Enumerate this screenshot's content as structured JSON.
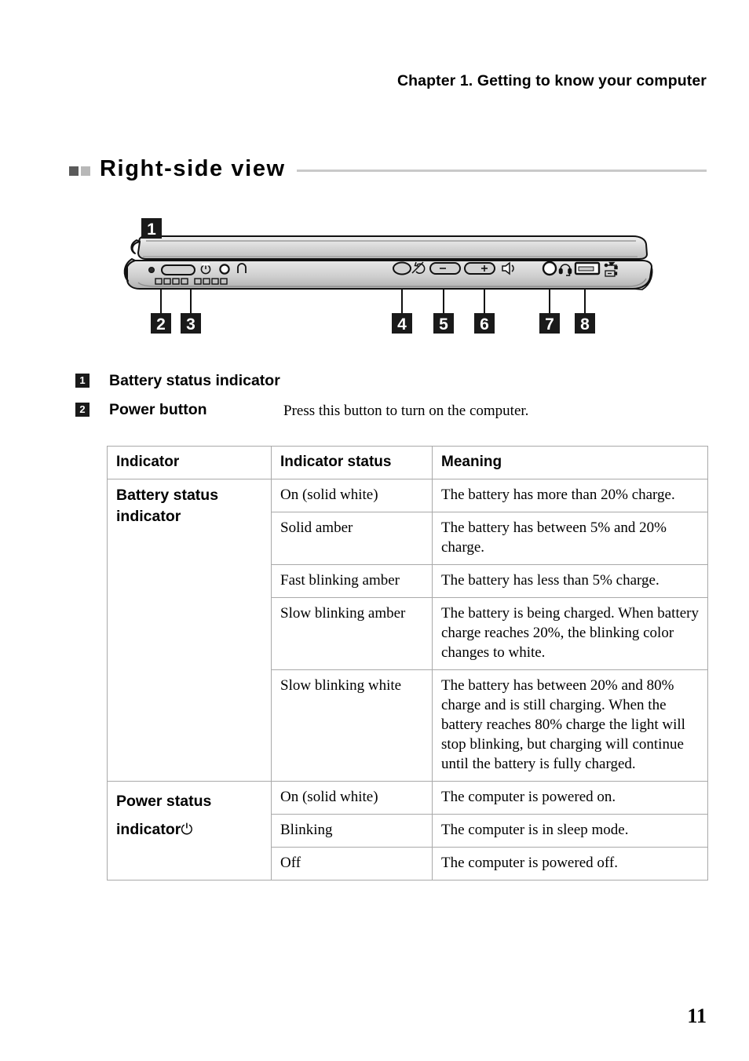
{
  "header": {
    "chapter": "Chapter 1. Getting to know your computer"
  },
  "section": {
    "title": "Right-side view",
    "bullet_dark_color": "#5a5a5a",
    "bullet_light_color": "#b8b8b8",
    "rule_color": "#c9c9c9"
  },
  "figure": {
    "alt": "right-side profile view of the computer",
    "callouts": [
      {
        "number": "1",
        "target": "battery-status-indicator"
      },
      {
        "number": "2",
        "target": "power-button"
      },
      {
        "number": "3",
        "target": "power-status-indicator"
      },
      {
        "number": "4",
        "target": "rotation-lock-button"
      },
      {
        "number": "5",
        "target": "volume-down-button"
      },
      {
        "number": "6",
        "target": "volume-up-button"
      },
      {
        "number": "7",
        "target": "audio-combo-jack"
      },
      {
        "number": "8",
        "target": "usb-port"
      }
    ],
    "icons": [
      "power-symbol-icon",
      "power-indicator-led-icon",
      "battery-indicator-led-icon",
      "rotation-lock-icon",
      "volume-minus-icon",
      "volume-plus-icon",
      "speaker-icon",
      "headset-icon",
      "usb-icon",
      "usb-charging-icon"
    ]
  },
  "items": [
    {
      "number": "1",
      "label": "Battery status indicator",
      "description": ""
    },
    {
      "number": "2",
      "label": "Power button",
      "description": "Press this button to turn on the computer."
    }
  ],
  "table": {
    "headers": [
      "Indicator",
      "Indicator status",
      "Meaning"
    ],
    "groups": [
      {
        "label": "Battery status indicator",
        "has_power_glyph": false,
        "rows": [
          {
            "status": "On (solid white)",
            "meaning": "The battery has more than 20% charge."
          },
          {
            "status": "Solid amber",
            "meaning": "The battery has between 5% and 20% charge."
          },
          {
            "status": "Fast blinking amber",
            "meaning": "The battery has less than 5% charge."
          },
          {
            "status": "Slow blinking amber",
            "meaning": "The battery is being charged. When battery charge reaches 20%, the blinking color changes to white."
          },
          {
            "status": "Slow blinking white",
            "meaning": "The battery has between 20% and 80% charge and is still charging. When the battery reaches 80% charge the light will stop blinking, but charging will continue until the battery is fully charged."
          }
        ]
      },
      {
        "label": "Power status indicator",
        "has_power_glyph": true,
        "power_glyph": "⏻",
        "rows": [
          {
            "status": "On (solid white)",
            "meaning": "The computer is powered on."
          },
          {
            "status": "Blinking",
            "meaning": "The computer is in sleep mode."
          },
          {
            "status": "Off",
            "meaning": "The computer is powered off."
          }
        ]
      }
    ]
  },
  "footer": {
    "page_number": "11"
  }
}
